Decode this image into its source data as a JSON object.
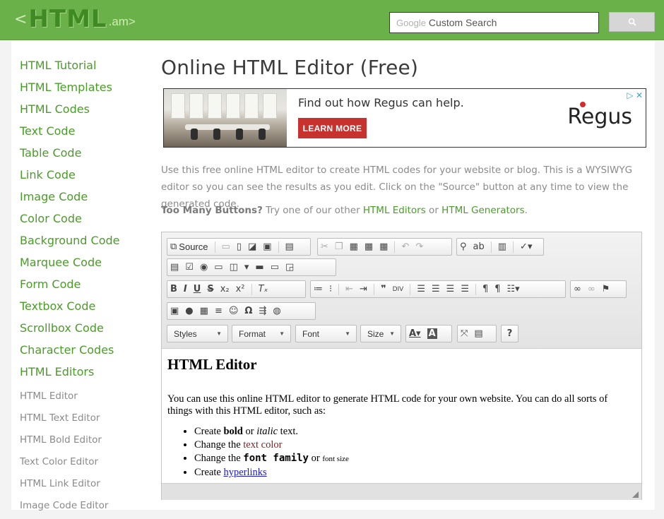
{
  "header": {
    "logo_lt": "<",
    "logo_main": "HTML",
    "logo_ext": ".am>",
    "search_google": "Google",
    "search_placeholder": "Custom Search",
    "search_button_icon": "magnifier-icon"
  },
  "sidebar": {
    "items": [
      "HTML Tutorial",
      "HTML Templates",
      "HTML Codes",
      "Text Code",
      "Table Code",
      "Link Code",
      "Image Code",
      "Color Code",
      "Background Code",
      "Marquee Code",
      "Form Code",
      "Textbox Code",
      "Scrollbox Code",
      "Character Codes",
      "HTML Editors"
    ],
    "sub_items": [
      "HTML Editor",
      "HTML Text Editor",
      "HTML Bold Editor",
      "Text Color Editor",
      "HTML Link Editor",
      "Image Code Editor"
    ]
  },
  "main": {
    "title": "Online HTML Editor (Free)",
    "ad": {
      "headline": "Find out how Regus can help.",
      "button": "LEARN MORE",
      "brand": "Regus",
      "close": "▷ ✕"
    },
    "intro": "Use this free online HTML editor to create HTML codes for your website or blog. This is a WYSIWYG editor so you can see the results as you edit. Click on the \"Source\" button at any time to view the generated code.",
    "many_bold": "Too Many Buttons?",
    "many_text1": " Try one of our other ",
    "many_link1": "HTML Editors",
    "many_text2": " or ",
    "many_link2": "HTML Generators",
    "many_text3": "."
  },
  "editor": {
    "source_label": "Source",
    "combos": [
      "Styles",
      "Format",
      "Font",
      "Size"
    ],
    "content": {
      "heading": "HTML Editor",
      "para": "You can use this online HTML editor to generate HTML code for your own website. You can do all sorts of things with this HTML editor, such as:",
      "li1_a": "Create ",
      "li1_bold": "bold",
      "li1_b": " or ",
      "li1_italic": "italic",
      "li1_c": " text.",
      "li2_a": "Change the ",
      "li2_red": "text color",
      "li3_a": "Change the ",
      "li3_mono": "font family",
      "li3_b": " or ",
      "li3_small": "font size",
      "li4_a": "Create ",
      "li4_link": "hyperlinks"
    }
  },
  "colors": {
    "header_green": "#6bb149",
    "link_green": "#4a9c28",
    "ad_button": "#c7322f"
  }
}
